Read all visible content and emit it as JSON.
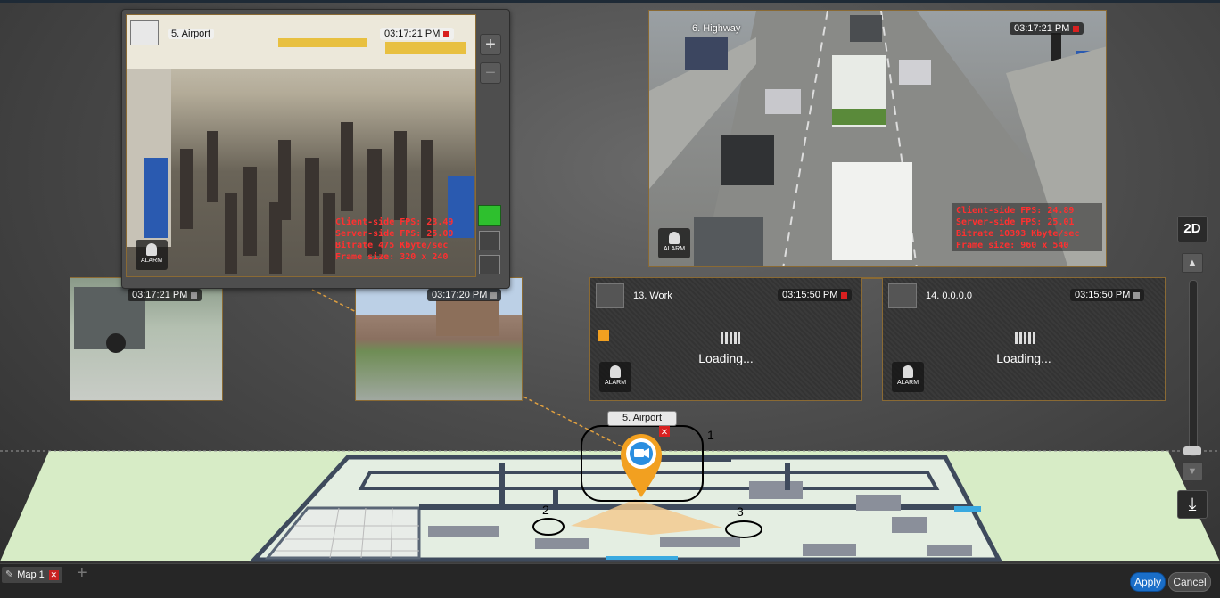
{
  "cameras": {
    "airport": {
      "name": "5. Airport",
      "time": "03:17:21 PM",
      "stats": [
        "Client-side FPS: 23.49",
        "Server-side FPS: 25.00",
        "Bitrate 475 Kbyte/sec",
        "Frame size: 320 x 240"
      ],
      "alarm": "ALARM"
    },
    "highway": {
      "name": "6. Highway",
      "time": "03:17:21 PM",
      "stats": [
        "Client-side FPS: 24.89",
        "Server-side FPS: 25.01",
        "Bitrate 10393 Kbyte/sec",
        "Frame size: 960 x 540"
      ],
      "alarm": "ALARM"
    },
    "truck": {
      "time": "03:17:21 PM"
    },
    "campus": {
      "time": "03:17:20 PM"
    },
    "work": {
      "name": "13. Work",
      "time": "03:15:50 PM",
      "loading": "Loading...",
      "alarm": "ALARM"
    },
    "ip": {
      "name": "14. 0.0.0.0",
      "time": "03:15:50 PM",
      "loading": "Loading...",
      "alarm": "ALARM"
    }
  },
  "map": {
    "pin_label": "5. Airport",
    "callouts": [
      "1",
      "2",
      "3"
    ]
  },
  "sidebar": {
    "plus": "+",
    "minus": "−"
  },
  "controls": {
    "mode_2d": "2D",
    "up": "▲",
    "down": "▼",
    "download": "⤓"
  },
  "tabs": [
    {
      "label": "Map 1",
      "close": "✕"
    }
  ],
  "add_tab": "+",
  "buttons": {
    "apply": "Apply",
    "cancel": "Cancel"
  },
  "colors": {
    "accent": "#1a6ec8",
    "alarm_red": "#ff3030",
    "border": "#8a6a34",
    "map_green": "#cfe8bf"
  }
}
